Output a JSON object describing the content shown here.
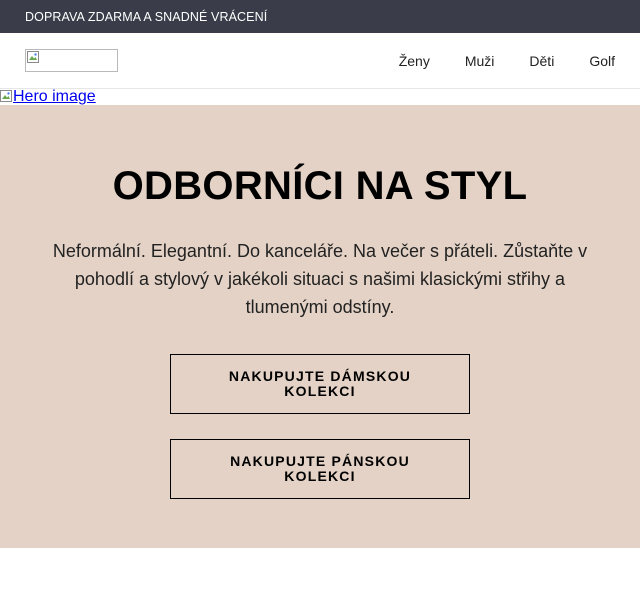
{
  "topbar": {
    "text": "DOPRAVA ZDARMA A SNADNÉ VRÁCENÍ"
  },
  "nav": {
    "items": [
      {
        "label": "Ženy"
      },
      {
        "label": "Muži"
      },
      {
        "label": "Děti"
      },
      {
        "label": "Golf"
      }
    ]
  },
  "hero": {
    "image_alt": "Hero image",
    "title": "ODBORNÍCI NA STYL",
    "description": "Neformální. Elegantní. Do kanceláře. Na večer s přáteli. Zůstaňte v pohodlí a stylový v jakékoli situaci s našimi klasickými střihy a tlumenými odstíny.",
    "buttons": [
      {
        "label": "NAKUPUJTE DÁMSKOU KOLEKCI"
      },
      {
        "label": "NAKUPUJTE PÁNSKOU KOLEKCI"
      }
    ]
  },
  "colors": {
    "topbar_bg": "#3a3d49",
    "hero_bg": "#e3d2c5",
    "link": "#0000ee"
  }
}
